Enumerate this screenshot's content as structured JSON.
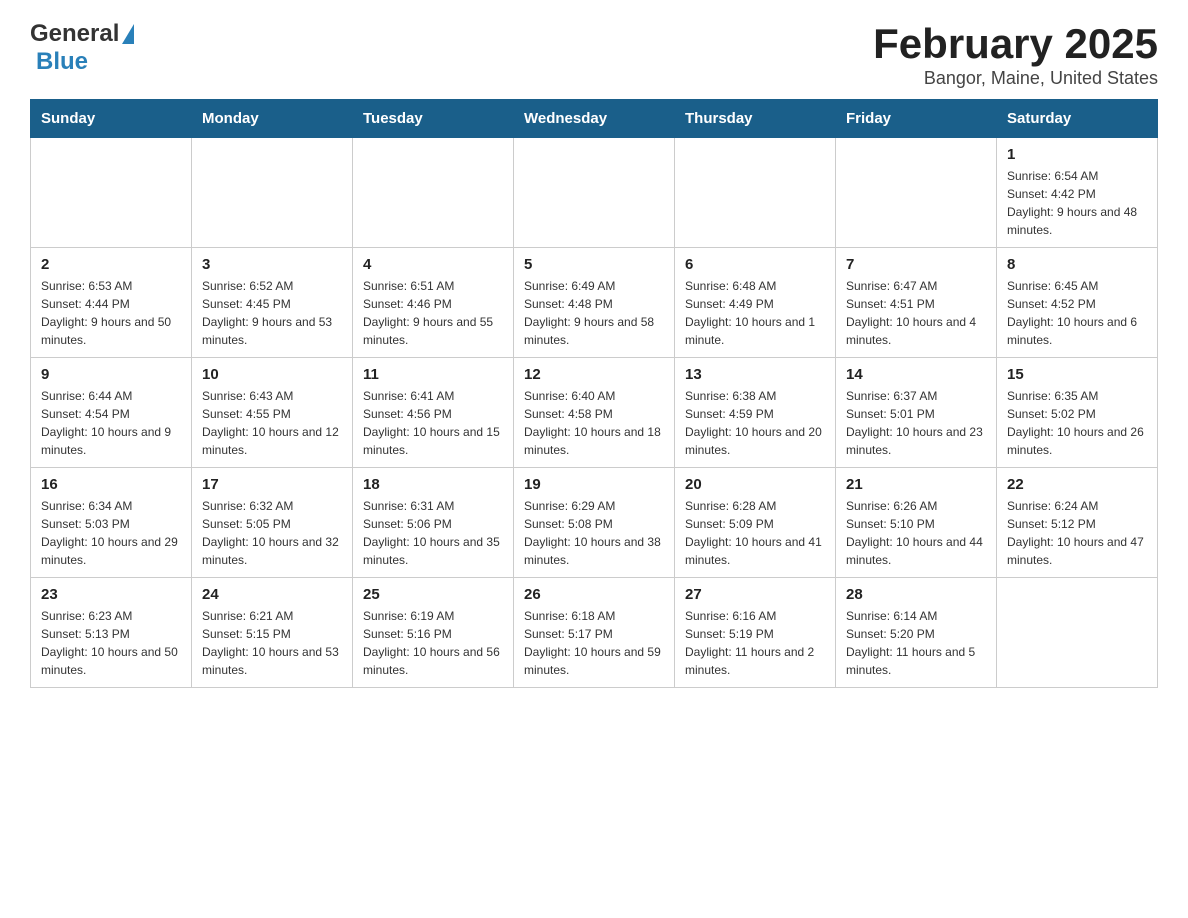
{
  "header": {
    "logo_general": "General",
    "logo_blue": "Blue",
    "title": "February 2025",
    "subtitle": "Bangor, Maine, United States"
  },
  "weekdays": [
    "Sunday",
    "Monday",
    "Tuesday",
    "Wednesday",
    "Thursday",
    "Friday",
    "Saturday"
  ],
  "weeks": [
    [
      {
        "day": "",
        "info": ""
      },
      {
        "day": "",
        "info": ""
      },
      {
        "day": "",
        "info": ""
      },
      {
        "day": "",
        "info": ""
      },
      {
        "day": "",
        "info": ""
      },
      {
        "day": "",
        "info": ""
      },
      {
        "day": "1",
        "info": "Sunrise: 6:54 AM\nSunset: 4:42 PM\nDaylight: 9 hours and 48 minutes."
      }
    ],
    [
      {
        "day": "2",
        "info": "Sunrise: 6:53 AM\nSunset: 4:44 PM\nDaylight: 9 hours and 50 minutes."
      },
      {
        "day": "3",
        "info": "Sunrise: 6:52 AM\nSunset: 4:45 PM\nDaylight: 9 hours and 53 minutes."
      },
      {
        "day": "4",
        "info": "Sunrise: 6:51 AM\nSunset: 4:46 PM\nDaylight: 9 hours and 55 minutes."
      },
      {
        "day": "5",
        "info": "Sunrise: 6:49 AM\nSunset: 4:48 PM\nDaylight: 9 hours and 58 minutes."
      },
      {
        "day": "6",
        "info": "Sunrise: 6:48 AM\nSunset: 4:49 PM\nDaylight: 10 hours and 1 minute."
      },
      {
        "day": "7",
        "info": "Sunrise: 6:47 AM\nSunset: 4:51 PM\nDaylight: 10 hours and 4 minutes."
      },
      {
        "day": "8",
        "info": "Sunrise: 6:45 AM\nSunset: 4:52 PM\nDaylight: 10 hours and 6 minutes."
      }
    ],
    [
      {
        "day": "9",
        "info": "Sunrise: 6:44 AM\nSunset: 4:54 PM\nDaylight: 10 hours and 9 minutes."
      },
      {
        "day": "10",
        "info": "Sunrise: 6:43 AM\nSunset: 4:55 PM\nDaylight: 10 hours and 12 minutes."
      },
      {
        "day": "11",
        "info": "Sunrise: 6:41 AM\nSunset: 4:56 PM\nDaylight: 10 hours and 15 minutes."
      },
      {
        "day": "12",
        "info": "Sunrise: 6:40 AM\nSunset: 4:58 PM\nDaylight: 10 hours and 18 minutes."
      },
      {
        "day": "13",
        "info": "Sunrise: 6:38 AM\nSunset: 4:59 PM\nDaylight: 10 hours and 20 minutes."
      },
      {
        "day": "14",
        "info": "Sunrise: 6:37 AM\nSunset: 5:01 PM\nDaylight: 10 hours and 23 minutes."
      },
      {
        "day": "15",
        "info": "Sunrise: 6:35 AM\nSunset: 5:02 PM\nDaylight: 10 hours and 26 minutes."
      }
    ],
    [
      {
        "day": "16",
        "info": "Sunrise: 6:34 AM\nSunset: 5:03 PM\nDaylight: 10 hours and 29 minutes."
      },
      {
        "day": "17",
        "info": "Sunrise: 6:32 AM\nSunset: 5:05 PM\nDaylight: 10 hours and 32 minutes."
      },
      {
        "day": "18",
        "info": "Sunrise: 6:31 AM\nSunset: 5:06 PM\nDaylight: 10 hours and 35 minutes."
      },
      {
        "day": "19",
        "info": "Sunrise: 6:29 AM\nSunset: 5:08 PM\nDaylight: 10 hours and 38 minutes."
      },
      {
        "day": "20",
        "info": "Sunrise: 6:28 AM\nSunset: 5:09 PM\nDaylight: 10 hours and 41 minutes."
      },
      {
        "day": "21",
        "info": "Sunrise: 6:26 AM\nSunset: 5:10 PM\nDaylight: 10 hours and 44 minutes."
      },
      {
        "day": "22",
        "info": "Sunrise: 6:24 AM\nSunset: 5:12 PM\nDaylight: 10 hours and 47 minutes."
      }
    ],
    [
      {
        "day": "23",
        "info": "Sunrise: 6:23 AM\nSunset: 5:13 PM\nDaylight: 10 hours and 50 minutes."
      },
      {
        "day": "24",
        "info": "Sunrise: 6:21 AM\nSunset: 5:15 PM\nDaylight: 10 hours and 53 minutes."
      },
      {
        "day": "25",
        "info": "Sunrise: 6:19 AM\nSunset: 5:16 PM\nDaylight: 10 hours and 56 minutes."
      },
      {
        "day": "26",
        "info": "Sunrise: 6:18 AM\nSunset: 5:17 PM\nDaylight: 10 hours and 59 minutes."
      },
      {
        "day": "27",
        "info": "Sunrise: 6:16 AM\nSunset: 5:19 PM\nDaylight: 11 hours and 2 minutes."
      },
      {
        "day": "28",
        "info": "Sunrise: 6:14 AM\nSunset: 5:20 PM\nDaylight: 11 hours and 5 minutes."
      },
      {
        "day": "",
        "info": ""
      }
    ]
  ]
}
